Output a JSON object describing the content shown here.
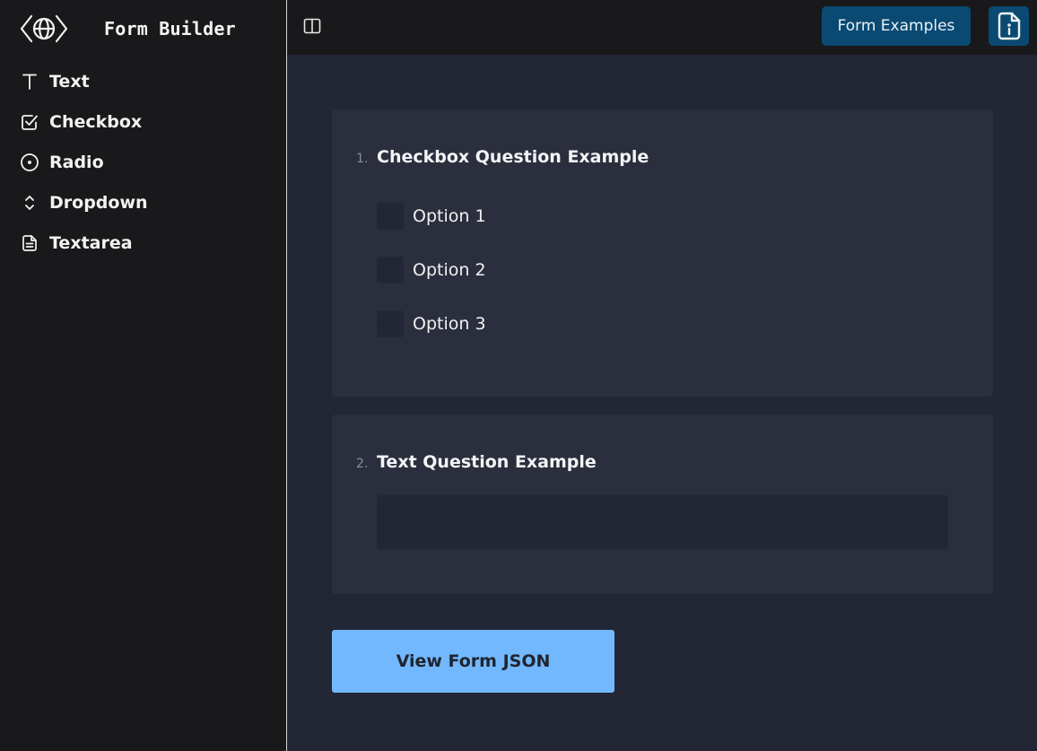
{
  "brand": {
    "title": "Form Builder",
    "logo_icon": "globe-code-icon"
  },
  "sidebar": {
    "items": [
      {
        "label": "Text",
        "icon": "text-type-icon"
      },
      {
        "label": "Checkbox",
        "icon": "checkbox-icon"
      },
      {
        "label": "Radio",
        "icon": "radio-icon"
      },
      {
        "label": "Dropdown",
        "icon": "chevrons-up-down-icon"
      },
      {
        "label": "Textarea",
        "icon": "file-text-icon"
      }
    ]
  },
  "topbar": {
    "toggle_icon": "sidebar-toggle-icon",
    "examples_label": "Form Examples",
    "info_icon": "file-info-icon"
  },
  "form": {
    "questions": [
      {
        "number": "1.",
        "title": "Checkbox Question Example",
        "type": "checkbox",
        "options": [
          "Option 1",
          "Option 2",
          "Option 3"
        ]
      },
      {
        "number": "2.",
        "title": "Text Question Example",
        "type": "text",
        "value": ""
      }
    ],
    "submit_label": "View Form JSON"
  },
  "colors": {
    "sidebar_bg": "#19191b",
    "main_bg": "#232634",
    "card_bg": "#2b2f3d",
    "accent_dark": "#0a4a72",
    "accent_light": "#72b8fe"
  }
}
